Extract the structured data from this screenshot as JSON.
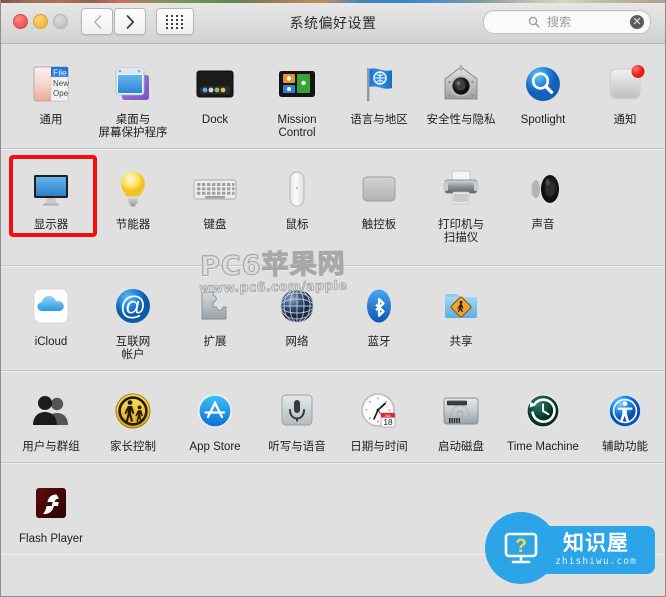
{
  "window": {
    "title": "系统偏好设置",
    "traffic": {
      "close": "close-button",
      "minimize": "minimize-button",
      "maximize": "maximize-button"
    },
    "nav": {
      "back": "‹",
      "forward": "›"
    },
    "grid_button": "show-all-grid"
  },
  "search": {
    "placeholder": "搜索",
    "value": "",
    "clear_glyph": "✕"
  },
  "annotation": {
    "target": "显示器",
    "color": "#f50d0d"
  },
  "watermarks": {
    "center": {
      "main": "PC6苹果网",
      "sub": "www.pc6.com/apple"
    },
    "corner": {
      "zh": "知识屋",
      "en": "zhishiwu.com",
      "color": "#2ba5e8"
    }
  },
  "rows": [
    {
      "items": [
        {
          "label": "通用",
          "icon": "general-icon"
        },
        {
          "label": "桌面与\n屏幕保护程序",
          "icon": "desktop-screensaver-icon"
        },
        {
          "label": "Dock",
          "icon": "dock-icon"
        },
        {
          "label": "Mission\nControl",
          "icon": "mission-control-icon"
        },
        {
          "label": "语言与地区",
          "icon": "language-region-flag-icon"
        },
        {
          "label": "安全性与隐私",
          "icon": "security-privacy-icon"
        },
        {
          "label": "Spotlight",
          "icon": "spotlight-icon"
        },
        {
          "label": "通知",
          "icon": "notifications-icon"
        }
      ]
    },
    {
      "items": [
        {
          "label": "显示器",
          "icon": "displays-monitor-icon"
        },
        {
          "label": "节能器",
          "icon": "energy-saver-bulb-icon"
        },
        {
          "label": "键盘",
          "icon": "keyboard-icon"
        },
        {
          "label": "鼠标",
          "icon": "mouse-icon"
        },
        {
          "label": "触控板",
          "icon": "trackpad-icon"
        },
        {
          "label": "打印机与\n扫描仪",
          "icon": "printers-scanners-icon"
        },
        {
          "label": "声音",
          "icon": "sound-speaker-icon"
        }
      ]
    },
    {
      "items": [
        {
          "label": "iCloud",
          "icon": "icloud-icon"
        },
        {
          "label": "互联网\n帐户",
          "icon": "internet-accounts-at-icon"
        },
        {
          "label": "扩展",
          "icon": "extensions-puzzle-icon"
        },
        {
          "label": "网络",
          "icon": "network-globe-icon"
        },
        {
          "label": "蓝牙",
          "icon": "bluetooth-icon"
        },
        {
          "label": "共享",
          "icon": "sharing-folder-icon"
        }
      ]
    },
    {
      "items": [
        {
          "label": "用户与群组",
          "icon": "users-groups-icon"
        },
        {
          "label": "家长控制",
          "icon": "parental-controls-icon"
        },
        {
          "label": "App Store",
          "icon": "app-store-icon"
        },
        {
          "label": "听写与语音",
          "icon": "dictation-speech-mic-icon"
        },
        {
          "label": "日期与时间",
          "icon": "date-time-clock-icon"
        },
        {
          "label": "启动磁盘",
          "icon": "startup-disk-icon"
        },
        {
          "label": "Time Machine",
          "icon": "time-machine-icon"
        },
        {
          "label": "辅助功能",
          "icon": "accessibility-icon"
        }
      ]
    },
    {
      "items": [
        {
          "label": "Flash Player",
          "icon": "flash-player-icon"
        }
      ]
    }
  ],
  "icon_extra": {
    "general_menu": {
      "title": "File",
      "item1": "New",
      "item2": "Ope"
    },
    "date_time_badge": {
      "month": "JUL",
      "day": "18"
    }
  }
}
